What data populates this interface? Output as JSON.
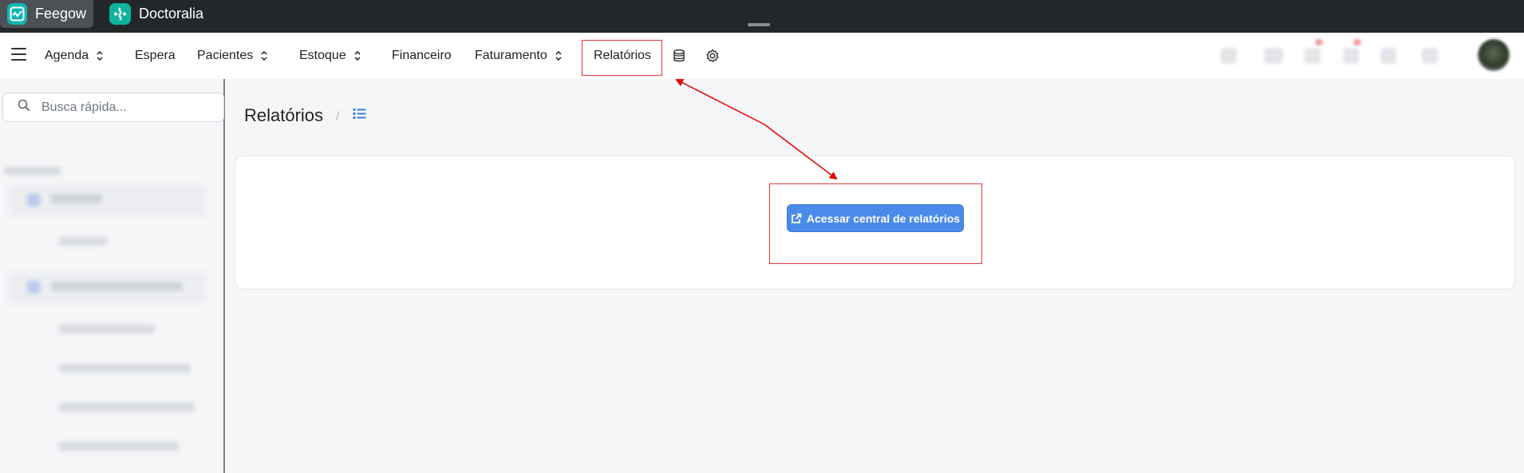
{
  "app_bar": {
    "tabs": [
      {
        "label": "Feegow",
        "icon": "feegow-logo-icon",
        "active": true
      },
      {
        "label": "Doctoralia",
        "icon": "doctoralia-logo-icon",
        "active": false
      }
    ]
  },
  "navbar": {
    "menu_icon": "hamburger-icon",
    "items": [
      {
        "label": "Agenda",
        "has_dropdown": true
      },
      {
        "label": "Espera",
        "has_dropdown": false
      },
      {
        "label": "Pacientes",
        "has_dropdown": true
      },
      {
        "label": "Estoque",
        "has_dropdown": true
      },
      {
        "label": "Financeiro",
        "has_dropdown": false
      },
      {
        "label": "Faturamento",
        "has_dropdown": true
      },
      {
        "label": "Relatórios",
        "has_dropdown": false,
        "highlighted": true
      }
    ],
    "icons": [
      "database-icon",
      "gear-icon"
    ]
  },
  "sidebar": {
    "search": {
      "placeholder": "Busca rápida...",
      "value": ""
    }
  },
  "main": {
    "title": "Relatórios",
    "breadcrumb_icon": "list-icon",
    "cta": {
      "label": "Acessar central de relatórios",
      "icon": "external-link-icon"
    }
  },
  "colors": {
    "appbar_bg": "#24272a",
    "accent": "#4a8ae8",
    "annotation": "#e53935"
  }
}
